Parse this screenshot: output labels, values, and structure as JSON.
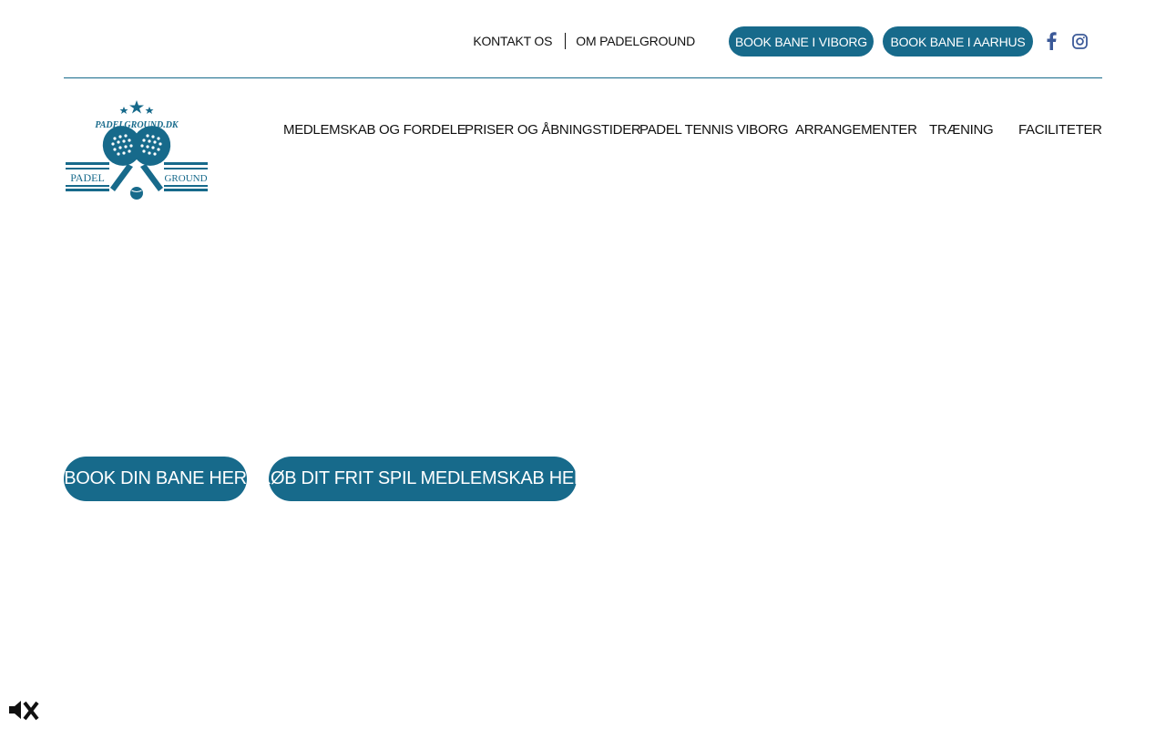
{
  "header": {
    "links": [
      {
        "label": "KONTAKT OS"
      },
      {
        "label": "OM PADELGROUND"
      }
    ],
    "book_buttons": [
      {
        "label": "BOOK BANE I VIBORG"
      },
      {
        "label": "BOOK BANE I AARHUS"
      }
    ],
    "social": [
      {
        "icon": "facebook-icon"
      },
      {
        "icon": "instagram-icon"
      }
    ]
  },
  "logo": {
    "top_text": "PADELGROUND.DK",
    "left_text": "PADEL",
    "right_text": "GROUND"
  },
  "nav": {
    "items": [
      {
        "label": "MEDLEMSKAB OG FORDELE"
      },
      {
        "label": "PRISER OG ÅBNINGSTIDER"
      },
      {
        "label": "PADEL TENNIS VIBORG"
      },
      {
        "label": "ARRANGEMENTER"
      },
      {
        "label": "TRÆNING"
      },
      {
        "label": "FACILITETER"
      }
    ]
  },
  "hero": {
    "book_button": "BOOK DIN BANE HER",
    "membership_button": "KØB DIT FRIT SPIL MEDLEMSKAB HER"
  },
  "video": {
    "mute_icon": "speaker-muted-icon"
  },
  "colors": {
    "brand": "#176a8b",
    "facebook": "#3b5998",
    "text": "#111111"
  }
}
